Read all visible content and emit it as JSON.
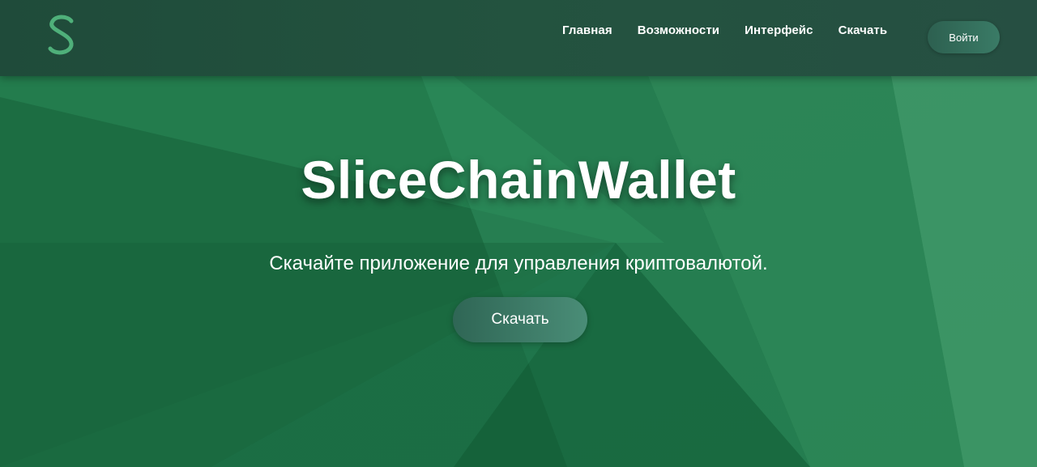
{
  "colors": {
    "background": "#1f6b45",
    "header": "#23533f",
    "accent": "#4fb07a",
    "button": "#3a7b66",
    "text": "#ffffff"
  },
  "header": {
    "logo_icon": "s-letter-logo-icon",
    "nav": [
      {
        "label": "Главная"
      },
      {
        "label": "Возможности"
      },
      {
        "label": "Интерфейс"
      },
      {
        "label": "Скачать"
      }
    ],
    "login_label": "Войти"
  },
  "hero": {
    "title": "SliceChainWallet",
    "subtitle": "Скачайте приложение для управления криптовалютой.",
    "download_label": "Скачать"
  }
}
